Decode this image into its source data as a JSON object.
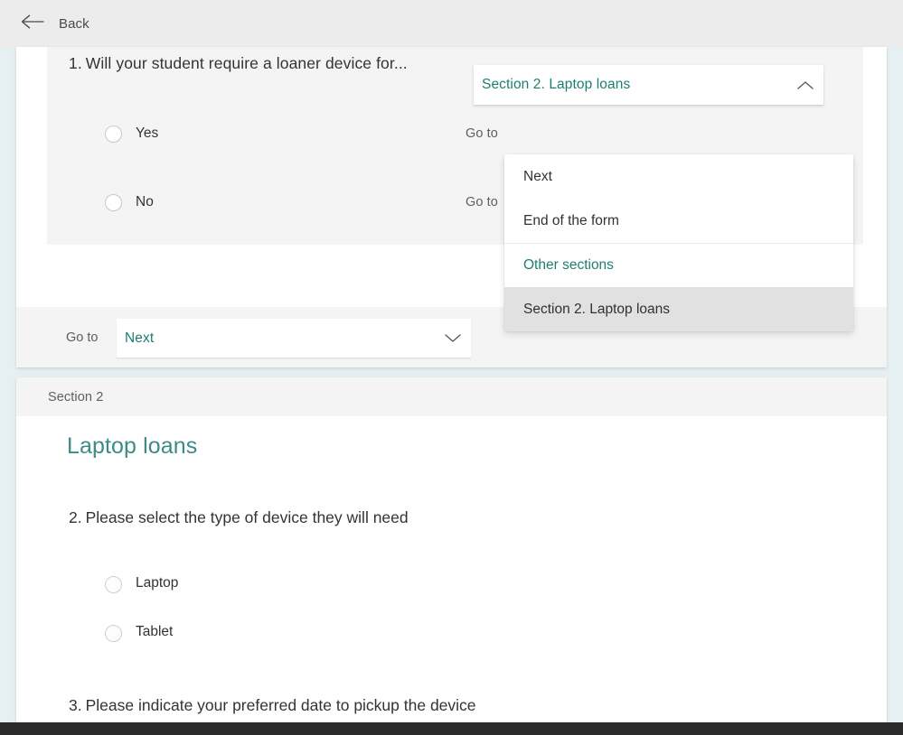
{
  "topbar": {
    "back_label": "Back",
    "back_icon": "arrow-left-icon"
  },
  "colors": {
    "accent_teal": "#1e7e72",
    "section_title_teal": "#3d8b86",
    "page_background": "#e6eff1",
    "block_gray": "#f4f4f4",
    "selected_gray": "#e1e1e1",
    "topbar_gray": "#ececec"
  },
  "section1": {
    "question": {
      "number": "1.",
      "text": "Will your student require a loaner device for...",
      "choices": [
        {
          "label": "Yes",
          "goto_label": "Go to",
          "goto_value": "Section 2. Laptop loans"
        },
        {
          "label": "No",
          "goto_label": "Go to",
          "goto_value": ""
        }
      ]
    },
    "footer": {
      "goto_label": "Go to",
      "goto_value": "Next",
      "caret_icon": "chevron-down-icon"
    }
  },
  "dropdown": {
    "expanded": true,
    "caret_icon": "chevron-up-icon",
    "selected_value": "Section 2. Laptop loans",
    "items": [
      {
        "label": "Next",
        "type": "option",
        "selected": false
      },
      {
        "label": "End of the form",
        "type": "option",
        "selected": false
      },
      {
        "label": "Other sections",
        "type": "group-header",
        "selected": false
      },
      {
        "label": "Section 2. Laptop loans",
        "type": "option",
        "selected": true
      }
    ]
  },
  "section2": {
    "header_label": "Section 2",
    "title": "Laptop loans",
    "question2": {
      "number": "2.",
      "text": "Please select the type of device they will need",
      "choices": [
        {
          "label": "Laptop"
        },
        {
          "label": "Tablet"
        }
      ]
    },
    "question3": {
      "number": "3.",
      "text": "Please indicate your preferred date to pickup the device"
    }
  }
}
